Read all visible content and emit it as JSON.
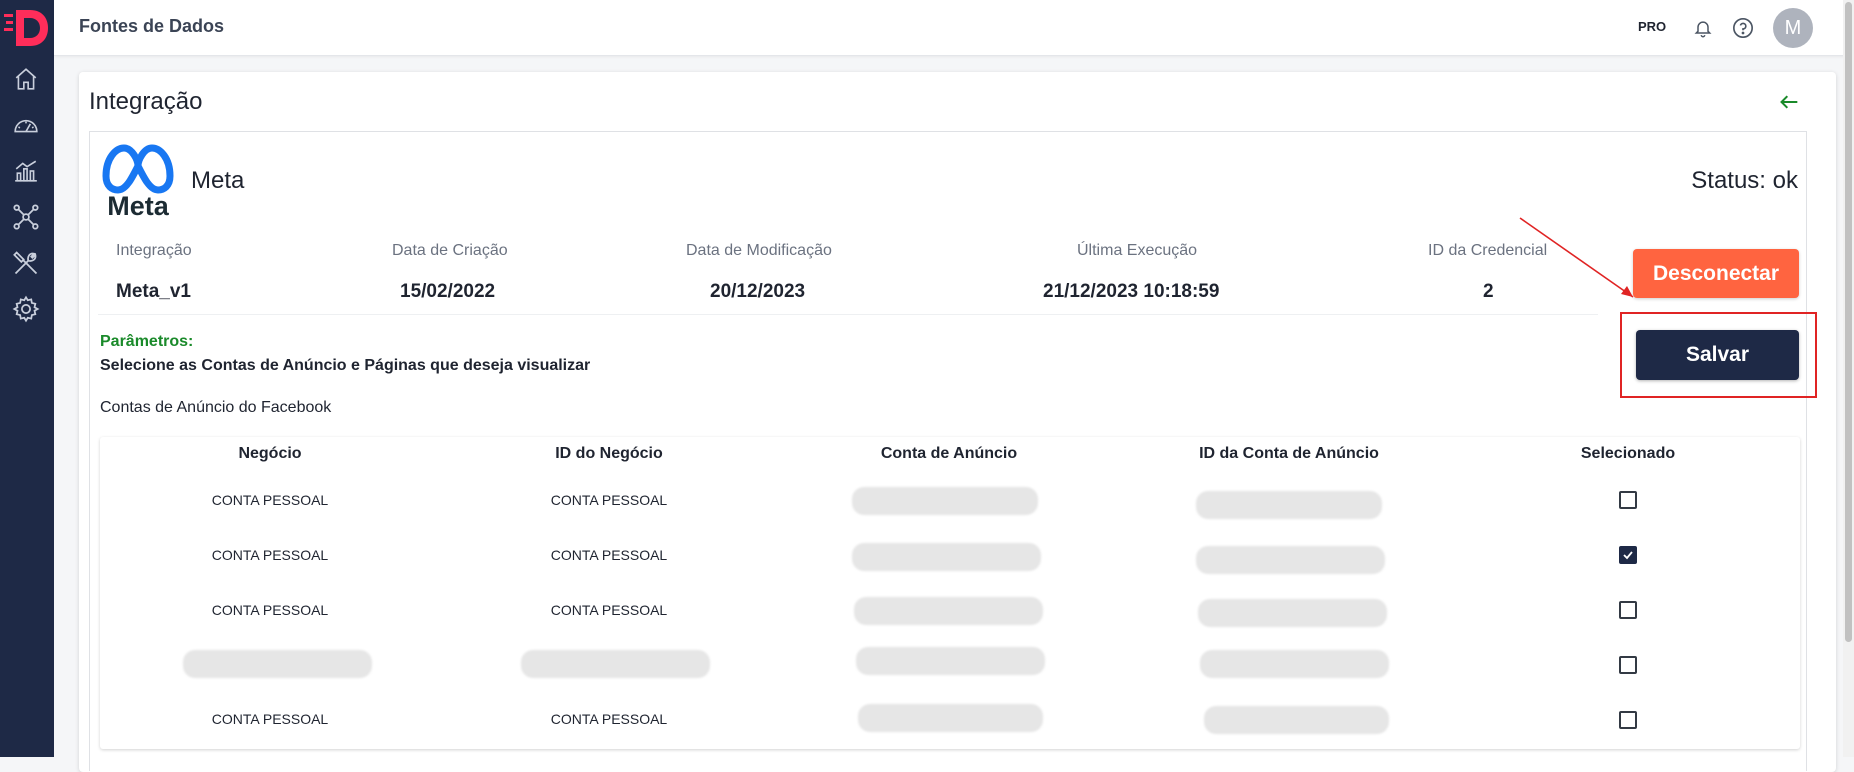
{
  "topbar": {
    "title": "Fontes de Dados",
    "plan_badge": "PRO",
    "avatar_initial": "M"
  },
  "sidebar": {
    "items": [
      {
        "icon": "home-icon"
      },
      {
        "icon": "dashboard-gauge-icon"
      },
      {
        "icon": "analytics-chart-icon"
      },
      {
        "icon": "network-nodes-icon"
      },
      {
        "icon": "tools-icon"
      },
      {
        "icon": "settings-gear-icon"
      }
    ]
  },
  "page": {
    "title": "Integração"
  },
  "integration": {
    "name": "Meta",
    "logo_text": "Meta",
    "status": "Status: ok",
    "fields": [
      {
        "label": "Integração",
        "value": "Meta_v1"
      },
      {
        "label": "Data de Criação",
        "value": "15/02/2022"
      },
      {
        "label": "Data de Modificação",
        "value": "20/12/2023"
      },
      {
        "label": "Última Execução",
        "value": "21/12/2023 10:18:59"
      },
      {
        "label": "ID da Credencial",
        "value": "2"
      }
    ],
    "disconnect_label": "Desconectar",
    "save_label": "Salvar"
  },
  "parameters": {
    "label": "Parâmetros:",
    "description": "Selecione as Contas de Anúncio e Páginas que deseja visualizar",
    "section_title": "Contas de Anúncio do Facebook"
  },
  "table": {
    "columns": [
      "Negócio",
      "ID do Negócio",
      "Conta de Anúncio",
      "ID da Conta de Anúncio",
      "Selecionado"
    ],
    "rows": [
      {
        "business": "CONTA PESSOAL",
        "business_id": "CONTA PESSOAL",
        "selected": false
      },
      {
        "business": "CONTA PESSOAL",
        "business_id": "CONTA PESSOAL",
        "selected": true
      },
      {
        "business": "CONTA PESSOAL",
        "business_id": "CONTA PESSOAL",
        "selected": false
      },
      {
        "business": "",
        "business_id": "",
        "selected": false
      },
      {
        "business": "CONTA PESSOAL",
        "business_id": "CONTA PESSOAL",
        "selected": false
      }
    ]
  },
  "colors": {
    "sidebar_bg": "#1e2946",
    "disconnect_button": "#ff6440",
    "save_button": "#1e2946",
    "parameters_label": "#1a8a2a",
    "highlight_annotation": "#e02424",
    "back_arrow": "#1a8a2a"
  }
}
